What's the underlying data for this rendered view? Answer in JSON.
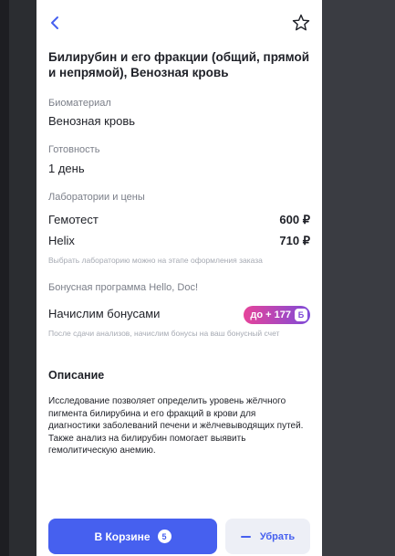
{
  "product": {
    "title": "Билирубин и его фракции (общий, прямой и непрямой), Венозная кровь"
  },
  "biomaterial": {
    "label": "Биоматериал",
    "value": "Венозная кровь"
  },
  "readiness": {
    "label": "Готовность",
    "value": "1 день"
  },
  "labs": {
    "label": "Лаборатории и цены",
    "items": [
      {
        "name": "Гемотест",
        "price": "600 ₽"
      },
      {
        "name": "Helix",
        "price": "710 ₽"
      }
    ],
    "hint": "Выбрать лабораторию можно на этапе оформления заказа"
  },
  "bonus": {
    "label": "Бонусная программа Hello, Doc!",
    "text": "Начислим бонусами",
    "badge": "до + 177",
    "coin": "Б",
    "hint": "После сдачи анализов, начислим бонусы на ваш бонусный счет"
  },
  "description": {
    "title": "Описание",
    "text": "Исследование позволяет определить уровень жёлчного пигмента билирубина и его фракций в крови для диагностики заболеваний печени и жёлчевыводящих путей. Также анализ на билирубин помогает выявить гемолитическую анемию."
  },
  "actions": {
    "cart_label": "В Корзине",
    "cart_count": "5",
    "remove_label": "Убрать"
  },
  "colors": {
    "accent": "#4660ef",
    "badge_from": "#e6439a",
    "badge_to": "#7f4bd8",
    "backdrop": "#2b2d31"
  },
  "icons": {
    "back": "chevron-left-icon",
    "favorite": "star-outline-icon"
  }
}
